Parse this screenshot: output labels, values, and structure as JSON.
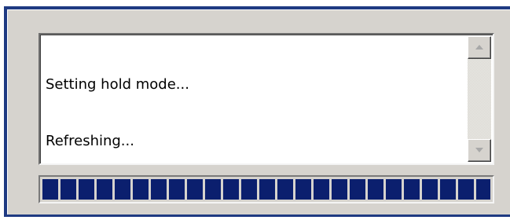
{
  "log": {
    "lines": [
      "Setting hold mode...",
      "Refreshing..."
    ]
  },
  "progress": {
    "fraction": 1.0,
    "color": "#0b1f6e"
  },
  "colors": {
    "frame_border": "#1f3a82",
    "dialog_background": "#d6d3ce"
  },
  "icons": {
    "scroll_up": "triangle-up",
    "scroll_down": "triangle-down"
  }
}
